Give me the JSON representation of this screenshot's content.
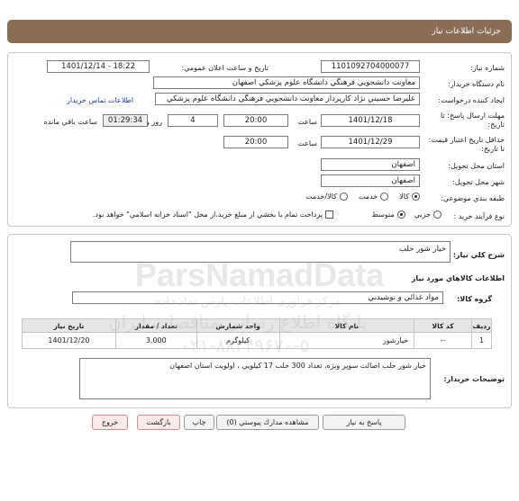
{
  "header": {
    "title": "جزئيات اطلاعات نياز"
  },
  "details": {
    "need_number_label": "شماره نياز:",
    "need_number": "1101092704000077",
    "announce_label": "تاريخ و ساعت اعلان عمومي:",
    "announce_value": "1401/12/14 - 18:22",
    "buyer_org_label": "نام دستگاه خريدار:",
    "buyer_org": "معاونت دانشجويي فرهنگي دانشگاه علوم پزشكي اصفهان",
    "creator_label": "ايجاد كننده درخواست:",
    "creator": "عليرضا حسيني نژاد كارپرداز معاونت دانشجويي فرهنگي دانشگاه علوم پزشكي",
    "contact_link": "اطلاعات تماس خريدار",
    "deadline_label": "مهلت ارسال پاسخ: تا تاريخ:",
    "deadline_date": "1401/12/18",
    "time_label": "ساعت",
    "deadline_time": "20:00",
    "days_value": "4",
    "days_label": "روز و",
    "remaining_time": "01:29:34",
    "remaining_label": "ساعت باقي مانده",
    "validity_label": "حداقل تاريخ اعتبار قيمت: تا تاريخ:",
    "validity_date": "1401/12/29",
    "validity_time_label": "ساعت",
    "validity_time": "20:00",
    "province_label": "استان محل تحويل:",
    "province": "اصفهان",
    "city_label": "شهر محل تحويل:",
    "city": "اصفهان",
    "category_label": "طبقه بندي موضوعي:",
    "category_options": [
      "كالا",
      "خدمت",
      "كالا/خدمت"
    ],
    "category_selected": 0,
    "process_label": "نوع فرآيند خريد :",
    "process_options": [
      "جزيي",
      "متوسط"
    ],
    "process_selected": 1,
    "payment_note": "پرداخت تمام يا بخشي از مبلغ خريد،از محل \"اسناد خزانه اسلامي\" خواهد بود."
  },
  "description": {
    "label": "شرح كلي نياز:",
    "value": "خيار شور حلب"
  },
  "goods": {
    "section_title": "اطلاعات كالاهاي مورد نياز",
    "group_label": "گروه كالا:",
    "group_value": "مواد غذائي و نوشيدني",
    "columns": [
      "رديف",
      "كد كالا",
      "نام كالا",
      "واحد شمارش",
      "تعداد / مقدار",
      "تاريخ نياز"
    ],
    "rows": [
      [
        "1",
        "--",
        "خيارشور",
        "كيلوگرم",
        "3,000",
        "1401/12/20"
      ]
    ]
  },
  "buyer_notes": {
    "label": "توضيحات خريدار:",
    "value": "خيار شور حلب اصالت سوپر ويژه، تعداد 300 حلب 17 كيلويي ، اولويت استان اصفهان"
  },
  "watermark": {
    "brand": "ParsNamadData",
    "line1": "مركز فراوري اطلاعات پارس نماد داده",
    "line2": "پايگاه اطلاع رساني مناقصات ايران",
    "phone": "۰۲۱-۸۸۳۴۹۶۷۰-۵"
  },
  "actions": {
    "reply": "پاسخ به نياز",
    "attachments": "مشاهده مدارك پيوستي (0)",
    "print": "چاپ",
    "back": "بازگشت",
    "exit": "خروج"
  }
}
